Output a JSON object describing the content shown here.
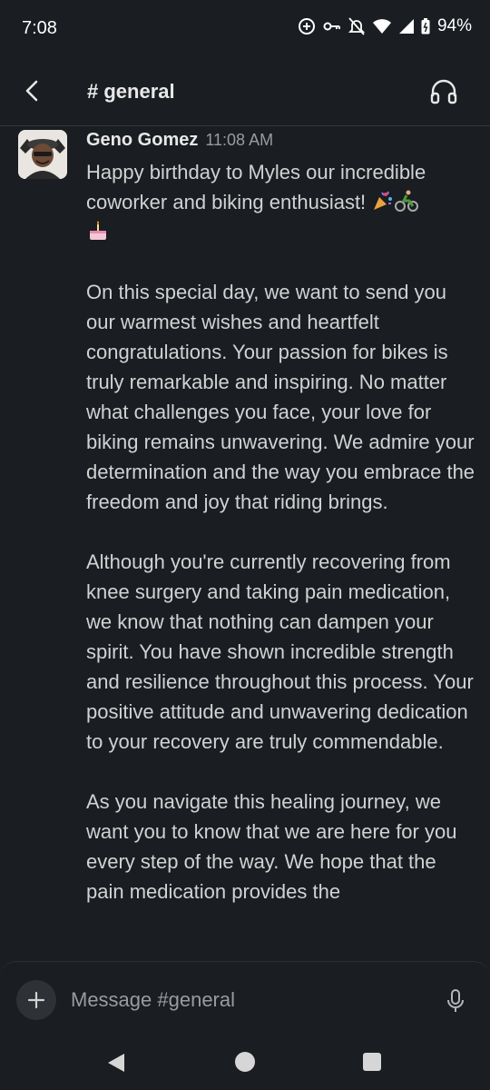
{
  "status": {
    "time": "7:08",
    "battery_percent": "94%",
    "icons": [
      "add-circle-icon",
      "vpn-key-icon",
      "notifications-off-icon",
      "wifi-icon",
      "cell-signal-icon",
      "battery-icon"
    ]
  },
  "header": {
    "title": "# general",
    "back_icon": "chevron-left-icon",
    "huddle_icon": "headphones-icon"
  },
  "message": {
    "sender": "Geno Gomez",
    "time": "11:08 AM",
    "paragraphs": [
      "Happy birthday to Myles our incredible coworker and biking enthusiast!",
      "On this special day, we want to send you our warmest wishes and heartfelt congratulations. Your passion for bikes is truly remarkable and inspiring. No matter what challenges you face, your love for biking remains unwavering. We admire your determination and the way you embrace the freedom and joy that riding brings.",
      "Although you're currently recovering from knee surgery and taking pain medication, we know that nothing can dampen your spirit. You have shown incredible strength and resilience throughout this process. Your positive attitude and unwavering dedication to your recovery are truly commendable.",
      "As you navigate this healing journey, we want you to know that we are here for you every step of the way. We hope that the pain medication provides the"
    ],
    "emojis": [
      "party-popper-emoji",
      "cyclist-emoji",
      "birthday-cake-emoji"
    ]
  },
  "composer": {
    "placeholder": "Message #general"
  },
  "colors": {
    "background": "#1a1d21",
    "text": "#d1d2d3",
    "muted": "#9a9b9d"
  }
}
